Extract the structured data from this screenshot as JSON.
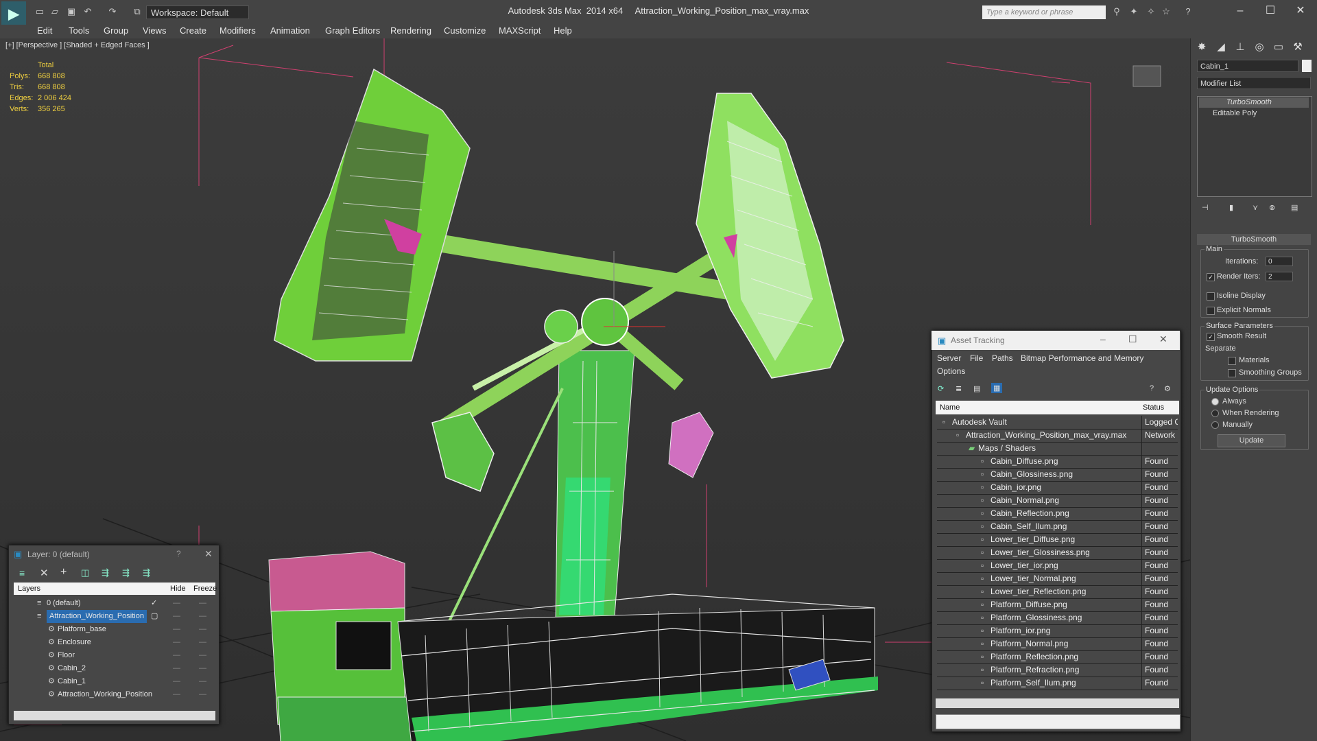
{
  "title_bar": {
    "workspace": "Workspace: Default",
    "title": "Autodesk 3ds Max  2014 x64     Attraction_Working_Position_max_vray.max",
    "search_placeholder": "Type a keyword or phrase"
  },
  "menu": [
    "Edit",
    "Tools",
    "Group",
    "Views",
    "Create",
    "Modifiers",
    "Animation",
    "Graph Editors",
    "Rendering",
    "Customize",
    "MAXScript",
    "Help"
  ],
  "viewport": {
    "label": "[+] [Perspective ] [Shaded + Edged Faces ]",
    "stats": {
      "header": "Total",
      "polys_label": "Polys:",
      "polys": "668 808",
      "tris_label": "Tris:",
      "tris": "668 808",
      "edges_label": "Edges:",
      "edges": "2 006 424",
      "verts_label": "Verts:",
      "verts": "356 265"
    }
  },
  "command_panel": {
    "object_name": "Cabin_1",
    "modifier_list": "Modifier List",
    "stack": [
      "TurboSmooth",
      "Editable Poly"
    ],
    "rollout_title": "TurboSmooth",
    "main_label": "Main",
    "iterations_label": "Iterations:",
    "iterations": "0",
    "render_iters_label": "Render Iters:",
    "render_iters": "2",
    "isoline": "Isoline Display",
    "explicit": "Explicit Normals",
    "surface_label": "Surface Parameters",
    "smooth_result": "Smooth Result",
    "separate": "Separate",
    "materials": "Materials",
    "smoothing_groups": "Smoothing Groups",
    "update_options": "Update Options",
    "always": "Always",
    "when_rendering": "When Rendering",
    "manually": "Manually",
    "update_button": "Update"
  },
  "asset_tracking": {
    "title": "Asset Tracking",
    "menu": [
      "Server",
      "File",
      "Paths",
      "Bitmap Performance and Memory",
      "Options"
    ],
    "col_name": "Name",
    "col_status": "Status",
    "rows": [
      {
        "name": "Autodesk Vault",
        "status": "Logged O"
      },
      {
        "name": "Attraction_Working_Position_max_vray.max",
        "status": "Network F"
      },
      {
        "name": "Maps / Shaders",
        "status": ""
      },
      {
        "name": "Cabin_Diffuse.png",
        "status": "Found"
      },
      {
        "name": "Cabin_Glossiness.png",
        "status": "Found"
      },
      {
        "name": "Cabin_ior.png",
        "status": "Found"
      },
      {
        "name": "Cabin_Normal.png",
        "status": "Found"
      },
      {
        "name": "Cabin_Reflection.png",
        "status": "Found"
      },
      {
        "name": "Cabin_Self_Ilum.png",
        "status": "Found"
      },
      {
        "name": "Lower_tier_Diffuse.png",
        "status": "Found"
      },
      {
        "name": "Lower_tier_Glossiness.png",
        "status": "Found"
      },
      {
        "name": "Lower_tier_ior.png",
        "status": "Found"
      },
      {
        "name": "Lower_tier_Normal.png",
        "status": "Found"
      },
      {
        "name": "Lower_tier_Reflection.png",
        "status": "Found"
      },
      {
        "name": "Platform_Diffuse.png",
        "status": "Found"
      },
      {
        "name": "Platform_Glossiness.png",
        "status": "Found"
      },
      {
        "name": "Platform_ior.png",
        "status": "Found"
      },
      {
        "name": "Platform_Normal.png",
        "status": "Found"
      },
      {
        "name": "Platform_Reflection.png",
        "status": "Found"
      },
      {
        "name": "Platform_Refraction.png",
        "status": "Found"
      },
      {
        "name": "Platform_Self_Ilum.png",
        "status": "Found"
      }
    ]
  },
  "layer_panel": {
    "title": "Layer: 0 (default)",
    "help": "?",
    "col_layers": "Layers",
    "col_hide": "Hide",
    "col_freeze": "Freeze",
    "rows": [
      "0 (default)",
      "Attraction_Working_Position",
      "Platform_base",
      "Enclosure",
      "Floor",
      "Cabin_2",
      "Cabin_1",
      "Attraction_Working_Position"
    ]
  }
}
